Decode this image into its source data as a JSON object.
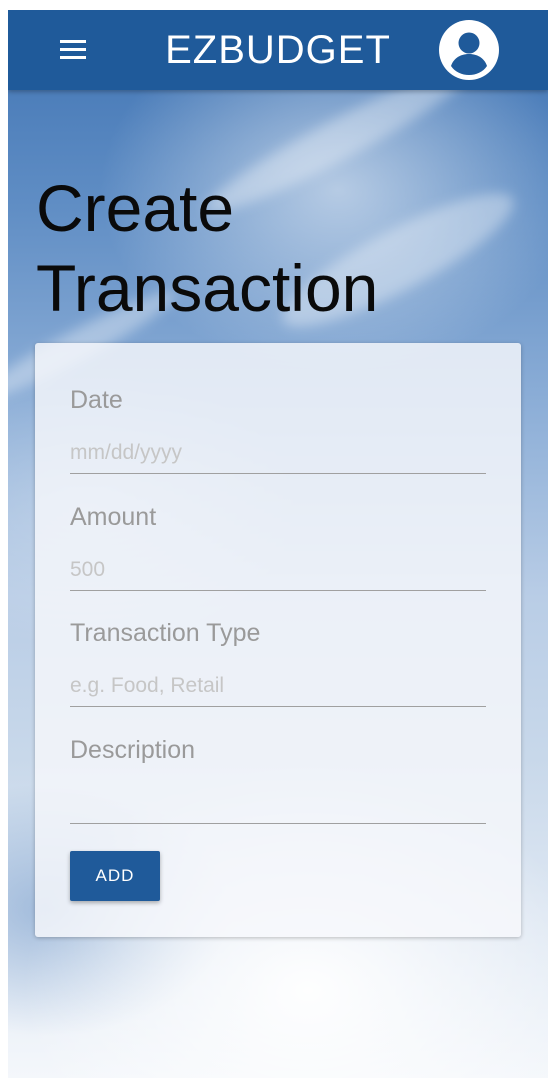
{
  "app": {
    "title": "EZBUDGET",
    "colors": {
      "primary": "#1f5a9a",
      "title_text": "#0a0a0a"
    },
    "icons": {
      "menu": "menu-icon",
      "account": "account-circle-icon"
    }
  },
  "page": {
    "title_line1": "Create",
    "title_line2": "Transaction"
  },
  "form": {
    "date": {
      "label": "Date",
      "placeholder": "mm/dd/yyyy",
      "value": ""
    },
    "amount": {
      "label": "Amount",
      "placeholder": "500",
      "value": ""
    },
    "transaction_type": {
      "label": "Transaction Type",
      "placeholder": "e.g. Food, Retail",
      "value": ""
    },
    "description": {
      "label": "Description",
      "placeholder": "",
      "value": ""
    },
    "submit_label": "ADD"
  }
}
